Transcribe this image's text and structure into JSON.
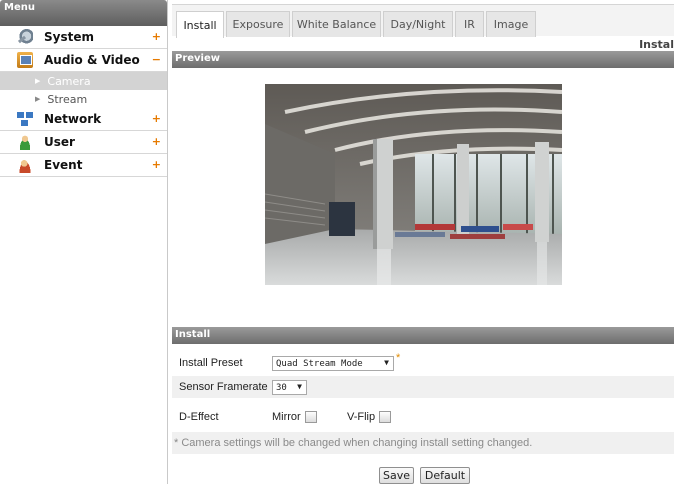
{
  "sidebar": {
    "header": "Menu",
    "items": [
      {
        "label": "System",
        "sign": "+",
        "icon": "system-icon"
      },
      {
        "label": "Audio & Video",
        "sign": "−",
        "icon": "audio-video-icon"
      },
      {
        "label": "Network",
        "sign": "+",
        "icon": "network-icon"
      },
      {
        "label": "User",
        "sign": "+",
        "icon": "user-icon"
      },
      {
        "label": "Event",
        "sign": "+",
        "icon": "event-icon"
      }
    ],
    "subitems": [
      {
        "label": "Camera",
        "active": true
      },
      {
        "label": "Stream",
        "active": false
      }
    ]
  },
  "tabs": [
    {
      "label": "Install",
      "active": true
    },
    {
      "label": "Exposure",
      "active": false
    },
    {
      "label": "White Balance",
      "active": false
    },
    {
      "label": "Day/Night",
      "active": false
    },
    {
      "label": "IR",
      "active": false
    },
    {
      "label": "Image",
      "active": false
    }
  ],
  "breadcrumb": "Instal",
  "preview": {
    "header": "Preview"
  },
  "install": {
    "header": "Install",
    "preset_label": "Install Preset",
    "preset_value": "Quad Stream Mode",
    "required_mark": "*",
    "framerate_label": "Sensor Framerate",
    "framerate_value": "30",
    "deffect_label": "D-Effect",
    "mirror_label": "Mirror",
    "vflip_label": "V-Flip",
    "mirror_checked": false,
    "vflip_checked": false,
    "note": "* Camera settings will be changed when changing install setting changed.",
    "save_label": "Save",
    "default_label": "Default"
  },
  "colors": {
    "accent_sign": "#e67a00",
    "header_gray": "#6d6d6d",
    "active_sub_bg": "#d3d3d3"
  }
}
